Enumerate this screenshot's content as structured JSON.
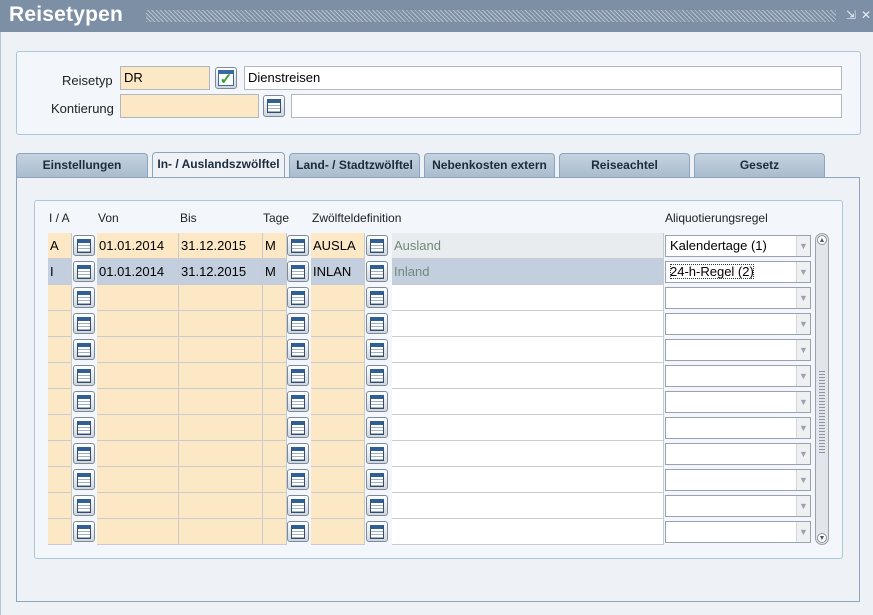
{
  "window": {
    "title": "Reisetypen",
    "controls": [
      "⇲",
      "✕"
    ]
  },
  "header": {
    "reisetyp": {
      "label": "Reisetyp",
      "value": "DR",
      "description": "Dienstreisen"
    },
    "kontierung": {
      "label": "Kontierung",
      "value": "",
      "description": ""
    }
  },
  "tabs": [
    {
      "label": "Einstellungen",
      "active": false
    },
    {
      "label": "In- / Auslandszwölftel",
      "active": true
    },
    {
      "label": "Land- / Stadtzwölftel",
      "active": false
    },
    {
      "label": "Nebenkosten extern",
      "active": false
    },
    {
      "label": "Reiseachtel",
      "active": false
    },
    {
      "label": "Gesetz",
      "active": false
    }
  ],
  "table": {
    "columns": {
      "ia": "I / A",
      "von": "Von",
      "bis": "Bis",
      "tage": "Tage",
      "zwoelftel": "Zwölfteldefinition",
      "aliquot": "Aliquotierungsregel"
    },
    "rows": [
      {
        "ia": "A",
        "von": "01.01.2014",
        "bis": "31.12.2015",
        "tage": "M",
        "code": "AUSLA",
        "desc": "Ausland",
        "regel": "Kalendertage (1)"
      },
      {
        "ia": "I",
        "von": "01.01.2014",
        "bis": "31.12.2015",
        "tage": "M",
        "code": "INLAN",
        "desc": "Inland",
        "regel": "24-h-Regel (2)"
      },
      {
        "ia": "",
        "von": "",
        "bis": "",
        "tage": "",
        "code": "",
        "desc": "",
        "regel": ""
      },
      {
        "ia": "",
        "von": "",
        "bis": "",
        "tage": "",
        "code": "",
        "desc": "",
        "regel": ""
      },
      {
        "ia": "",
        "von": "",
        "bis": "",
        "tage": "",
        "code": "",
        "desc": "",
        "regel": ""
      },
      {
        "ia": "",
        "von": "",
        "bis": "",
        "tage": "",
        "code": "",
        "desc": "",
        "regel": ""
      },
      {
        "ia": "",
        "von": "",
        "bis": "",
        "tage": "",
        "code": "",
        "desc": "",
        "regel": ""
      },
      {
        "ia": "",
        "von": "",
        "bis": "",
        "tage": "",
        "code": "",
        "desc": "",
        "regel": ""
      },
      {
        "ia": "",
        "von": "",
        "bis": "",
        "tage": "",
        "code": "",
        "desc": "",
        "regel": ""
      },
      {
        "ia": "",
        "von": "",
        "bis": "",
        "tage": "",
        "code": "",
        "desc": "",
        "regel": ""
      },
      {
        "ia": "",
        "von": "",
        "bis": "",
        "tage": "",
        "code": "",
        "desc": "",
        "regel": ""
      },
      {
        "ia": "",
        "von": "",
        "bis": "",
        "tage": "",
        "code": "",
        "desc": "",
        "regel": ""
      }
    ],
    "selected_row": 1
  },
  "icons": {
    "list_of_values": "calendar-list-icon",
    "confirm": "check-icon",
    "dropdown": "chevron-down-icon"
  },
  "colors": {
    "titlebar": "#7d8fa5",
    "required_field": "#fde8c6",
    "selected_row": "#c3cfde",
    "tab": "#b5c5d6"
  }
}
